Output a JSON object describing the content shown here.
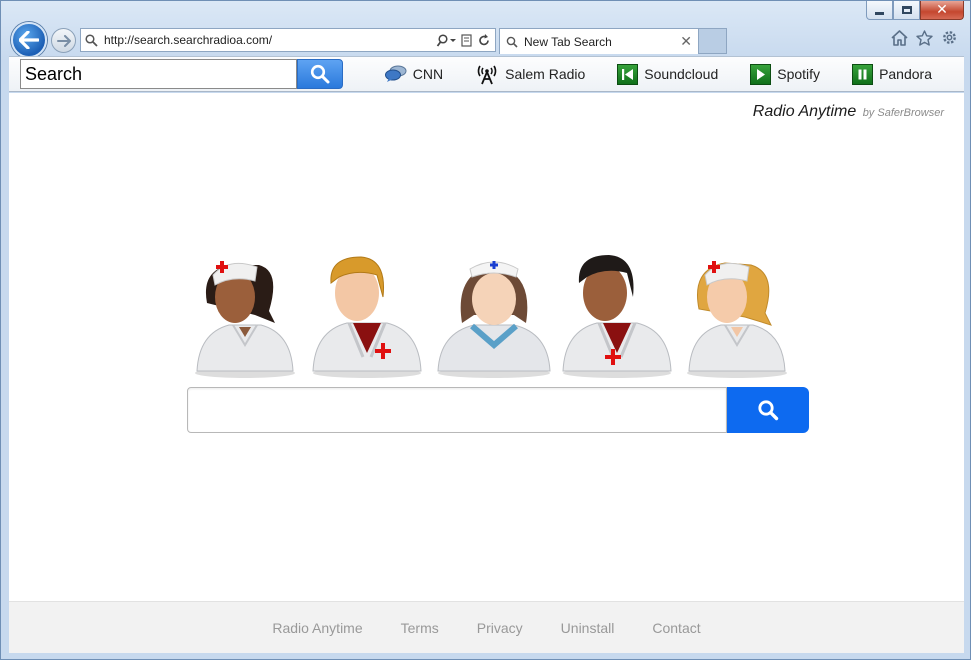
{
  "browser": {
    "address_url": "http://search.searchradioa.com/",
    "tab_title": "New Tab Search"
  },
  "toolbar": {
    "search_placeholder": "Search",
    "links": [
      {
        "label": "CNN",
        "icon": "cnn-chat-icon"
      },
      {
        "label": "Salem Radio",
        "icon": "radio-tower-icon"
      },
      {
        "label": "Soundcloud",
        "icon": "skip-back-icon"
      },
      {
        "label": "Spotify",
        "icon": "play-icon"
      },
      {
        "label": "Pandora",
        "icon": "pause-icon"
      }
    ]
  },
  "page": {
    "brand_name": "Radio Anytime",
    "brand_by": "by SaferBrowser"
  },
  "footer": {
    "links": [
      "Radio Anytime",
      "Terms",
      "Privacy",
      "Uninstall",
      "Contact"
    ]
  },
  "colors": {
    "search_button": "#0d6af0",
    "toolbar_search_button": "#2a79dc",
    "media_icon_green": "#1f8a2a",
    "red_cross": "#e01010"
  }
}
